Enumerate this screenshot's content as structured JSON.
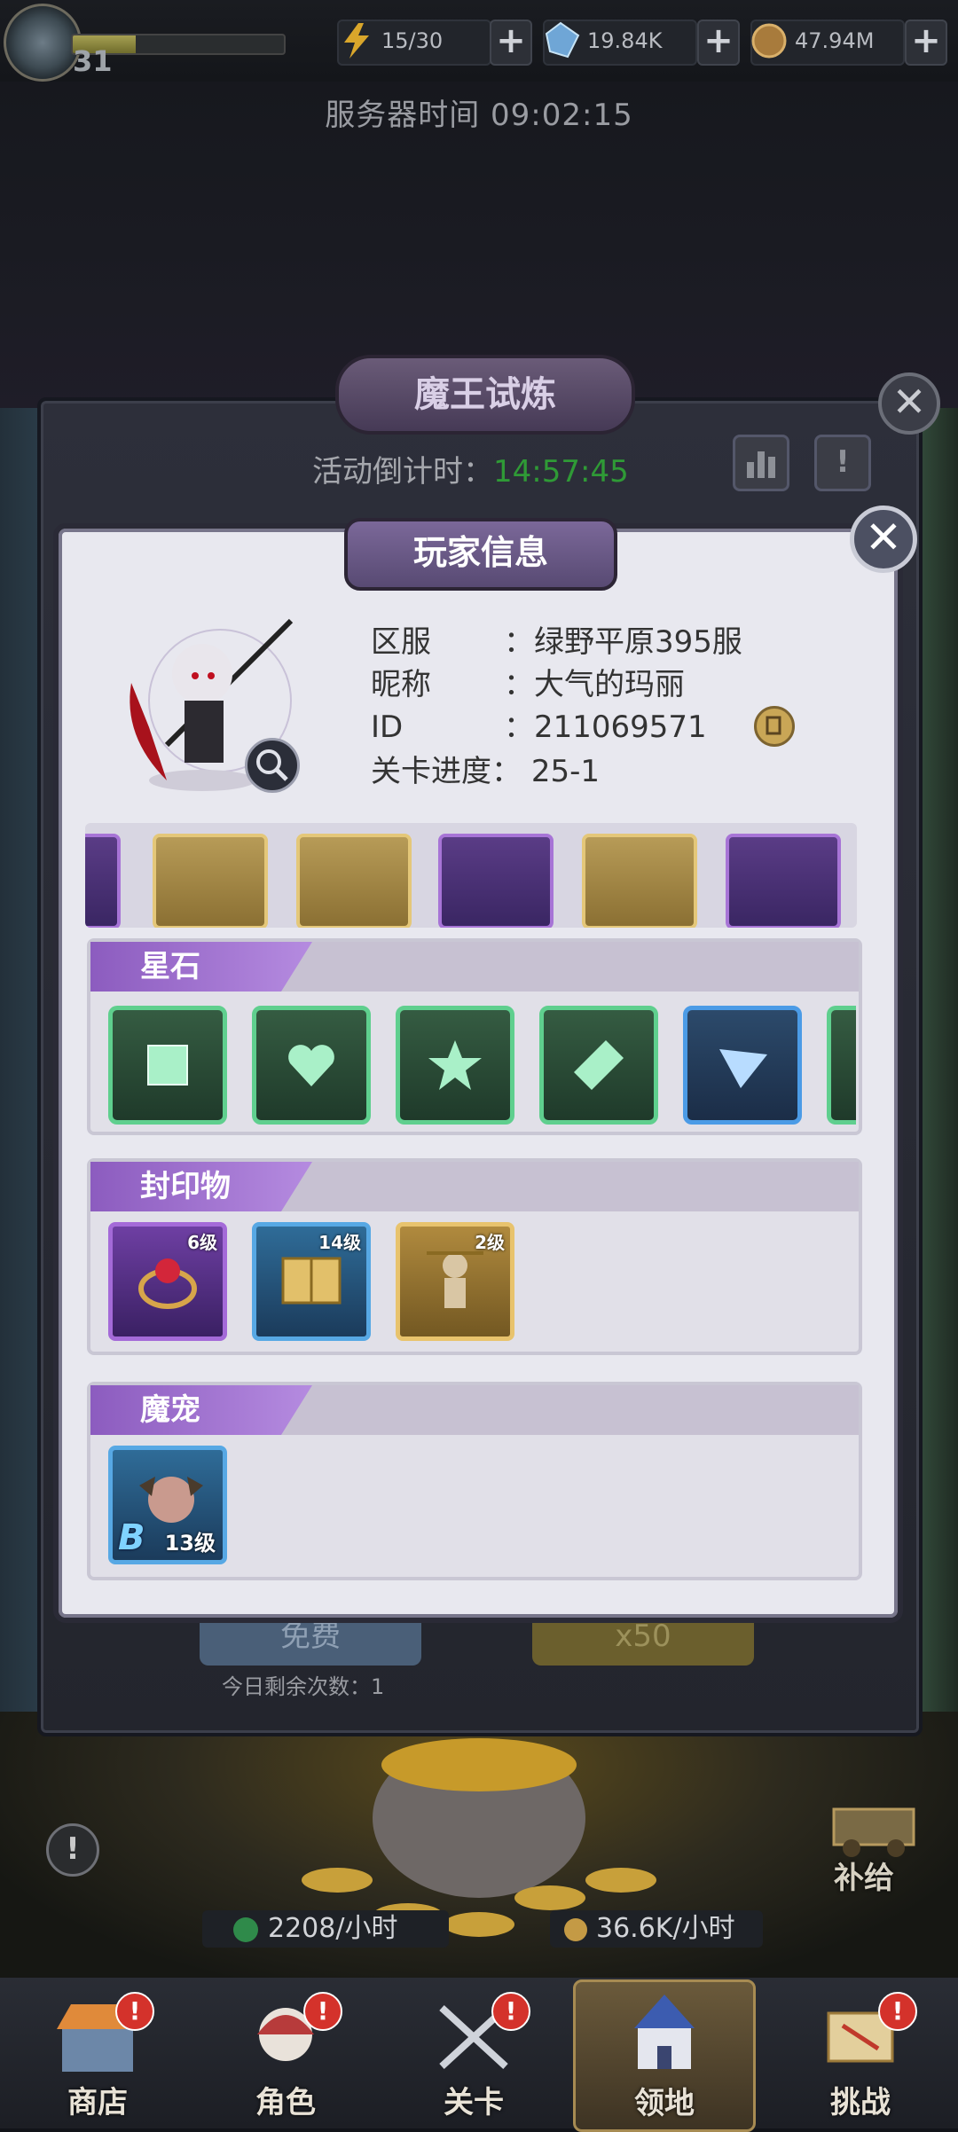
{
  "topbar": {
    "level": "31",
    "xp_progress": 0.3,
    "energy": "15/30",
    "gems": "19.84K",
    "coins": "47.94M",
    "plus_label": "+"
  },
  "server_time": "服务器时间 09:02:15",
  "trial": {
    "title": "魔王试炼",
    "countdown_label": "活动倒计时：",
    "countdown_value": "14:57:45",
    "free_label": "免费",
    "x50_label": "x50",
    "remaining_label": "今日剩余次数：1",
    "close": "✕",
    "rank_icon": "rank-icon",
    "info_icon": "!"
  },
  "modal": {
    "title": "玩家信息",
    "close": "✕",
    "server_label": "区服",
    "server_value": "：绿野平原395服",
    "nickname_label": "昵称",
    "nickname_value": "：大气的玛丽",
    "id_label": "ID",
    "id_value": "：211069571",
    "progress_label": "关卡进度：",
    "progress_value": "25-1"
  },
  "sections": {
    "star_stone": {
      "title": "星石"
    },
    "seals": {
      "title": "封印物",
      "items": [
        {
          "level": "6级",
          "name": "ring",
          "color": "purple"
        },
        {
          "level": "14级",
          "name": "golden-book",
          "color": "blue"
        },
        {
          "level": "2级",
          "name": "puppet",
          "color": "gold"
        }
      ]
    },
    "pets": {
      "title": "魔宠",
      "items": [
        {
          "grade": "B",
          "level": "13级"
        }
      ]
    }
  },
  "bottom": {
    "supply": "补给",
    "exp_rate": "2208/小时",
    "coin_rate": "36.6K/小时",
    "alert": "!"
  },
  "nav": {
    "items": [
      {
        "label": "商店",
        "badge": "!"
      },
      {
        "label": "角色",
        "badge": "!"
      },
      {
        "label": "关卡",
        "badge": "!"
      },
      {
        "label": "领地",
        "badge": ""
      },
      {
        "label": "挑战",
        "badge": "!"
      }
    ]
  },
  "colors": {
    "accent_purple": "#a774d6",
    "countdown_green": "#2f9a36",
    "gem_green": "#5fcf8e",
    "gem_blue": "#4b9be6"
  }
}
